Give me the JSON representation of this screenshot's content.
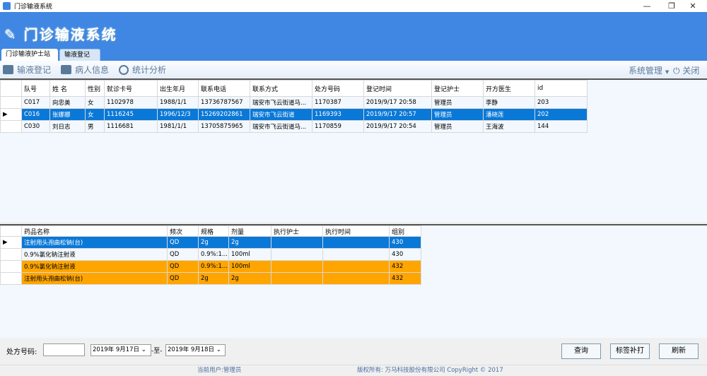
{
  "window": {
    "title": "门诊输液系统",
    "minimize": "—",
    "restore": "❐",
    "close": "✕"
  },
  "header": {
    "logo_text": "门诊输液系统"
  },
  "tabs": [
    {
      "label": "门诊输液护士站"
    },
    {
      "label": "输液登记"
    }
  ],
  "toolbar": {
    "items": [
      {
        "label": "输液登记",
        "icon": "register-icon"
      },
      {
        "label": "病人信息",
        "icon": "camera-icon"
      },
      {
        "label": "统计分析",
        "icon": "clock-icon"
      }
    ],
    "system_menu": "系统管理",
    "close_label": "关闭"
  },
  "patients": {
    "columns": [
      "队号",
      "姓 名",
      "性别",
      "就诊卡号",
      "出生年月",
      "联系电话",
      "联系方式",
      "处方号码",
      "登记时间",
      "登记护士",
      "开方医生",
      "id"
    ],
    "rows": [
      [
        "C017",
        "向忠美",
        "女",
        "1102978",
        "1988/1/1",
        "13736787567",
        "瑞安市飞云街道马...",
        "1170387",
        "2019/9/17 20:58",
        "管理员",
        "李静",
        "203"
      ],
      [
        "C016",
        "张娜娜",
        "女",
        "1116245",
        "1996/12/3",
        "15269202861",
        "瑞安市飞云街道",
        "1169393",
        "2019/9/17 20:57",
        "管理员",
        "潘晓莲",
        "202"
      ],
      [
        "C030",
        "刘日志",
        "男",
        "1116681",
        "1981/1/1",
        "13705875965",
        "瑞安市飞云街道马...",
        "1170859",
        "2019/9/17 20:54",
        "管理员",
        "王海波",
        "144"
      ]
    ],
    "selected_row": 1
  },
  "drugs": {
    "columns": [
      "药品名称",
      "频次",
      "规格",
      "剂量",
      "执行护士",
      "执行时间",
      "组别"
    ],
    "rows": [
      [
        "注射用头孢曲松钠(台)",
        "QD",
        "2g",
        "2g",
        "",
        "",
        "430"
      ],
      [
        "0.9%氯化钠注射液",
        "QD",
        "0.9%:1...",
        "100ml",
        "",
        "",
        "430"
      ],
      [
        "0.9%氯化钠注射液",
        "QD",
        "0.9%:1...",
        "100ml",
        "",
        "",
        "432"
      ],
      [
        "注射用头孢曲松钠(台)",
        "QD",
        "2g",
        "2g",
        "",
        "",
        "432"
      ]
    ],
    "selected_row": 0,
    "highlight_rows": [
      2,
      3
    ]
  },
  "filters": {
    "rx_label": "处方号码:",
    "rx_value": "",
    "date_from": "2019年 9月17日",
    "to_label": "-至-",
    "date_to": "2019年 9月18日"
  },
  "buttons": {
    "query": "查询",
    "reprint": "标签补打",
    "refresh": "刷新"
  },
  "footer": {
    "user": "当前用户:管理员",
    "copyright": "版权所有: 万马科技股份有限公司 CopyRight © 2017"
  },
  "colors": {
    "header": "#3f87e2",
    "selected": "#0a78d7",
    "highlight": "#fea500"
  }
}
